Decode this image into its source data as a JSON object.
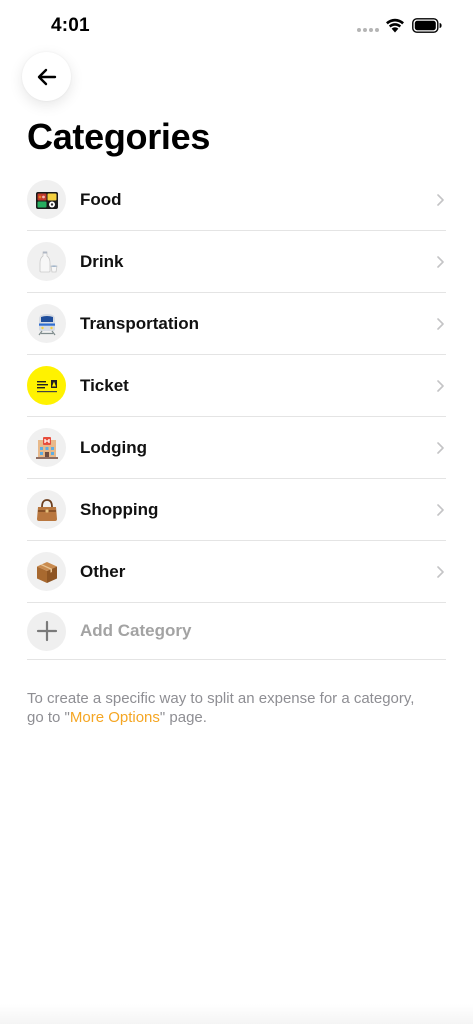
{
  "status_bar": {
    "time": "4:01"
  },
  "header": {
    "back_icon": "arrow-left-icon",
    "title": "Categories"
  },
  "categories": [
    {
      "label": "Food",
      "icon": "bento-box-icon"
    },
    {
      "label": "Drink",
      "icon": "sake-bottle-icon"
    },
    {
      "label": "Transportation",
      "icon": "train-icon"
    },
    {
      "label": "Ticket",
      "icon": "ticket-icon"
    },
    {
      "label": "Lodging",
      "icon": "hotel-icon"
    },
    {
      "label": "Shopping",
      "icon": "handbag-icon"
    },
    {
      "label": "Other",
      "icon": "package-icon"
    }
  ],
  "add_category": {
    "label": "Add Category",
    "icon": "plus-icon"
  },
  "footnote": {
    "prefix": "To create a specific way to split an expense for a category, go to \"",
    "link": "More Options",
    "suffix": "\" page."
  },
  "colors": {
    "accent": "#f5a623",
    "separator": "#e4e4e4",
    "muted_text": "#8e8e93",
    "icon_bg": "#f0f0f0"
  }
}
